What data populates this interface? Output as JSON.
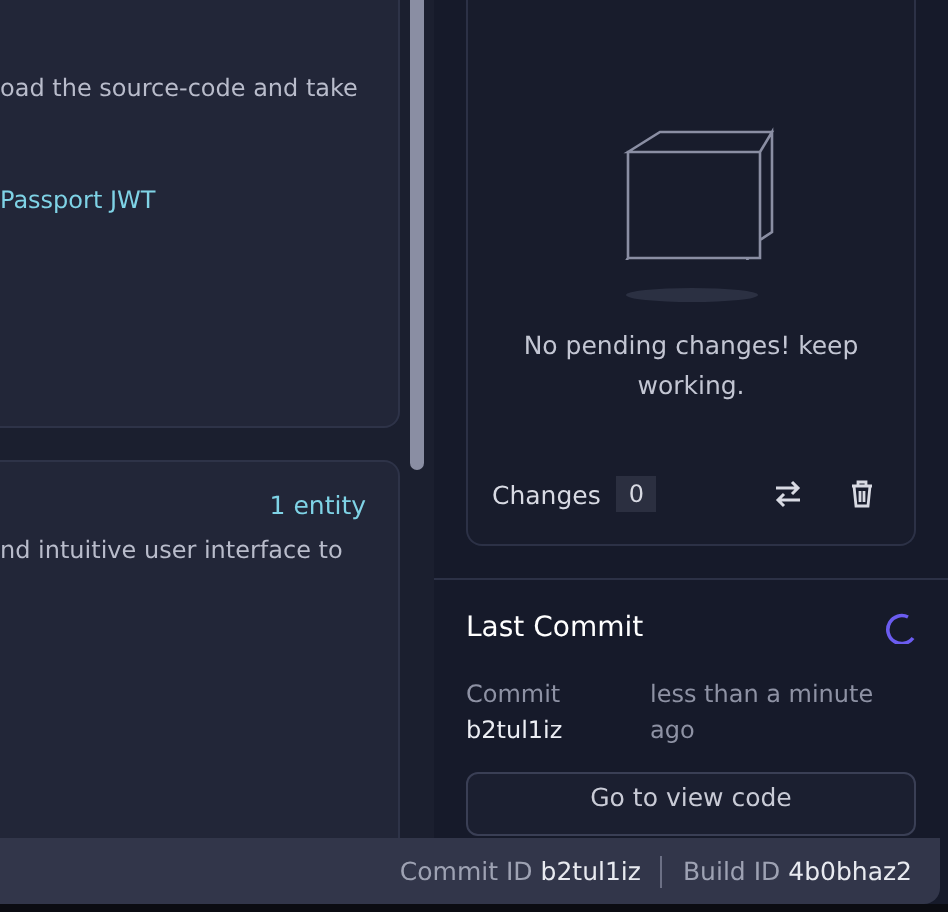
{
  "cards": [
    {
      "lines": [
        {
          "kind": "body",
          "text": "oad the source-code and take"
        },
        {
          "kind": "accent",
          "text": "Passport JWT"
        }
      ]
    },
    {
      "count": "1 entity",
      "lines": [
        {
          "kind": "body",
          "text": "nd intuitive user interface to"
        }
      ]
    }
  ],
  "changes_panel": {
    "message": "No pending changes! keep working.",
    "label": "Changes",
    "count": "0"
  },
  "last_commit": {
    "title": "Last Commit",
    "loading": true,
    "label": "Commit",
    "id": "b2tul1iz",
    "time": "less than a minute ago",
    "button": "Go to view code"
  },
  "status_bar": [
    {
      "label": "Commit ID",
      "value": "b2tul1iz"
    },
    {
      "label": "Build ID",
      "value": "4b0bhaz2"
    }
  ]
}
